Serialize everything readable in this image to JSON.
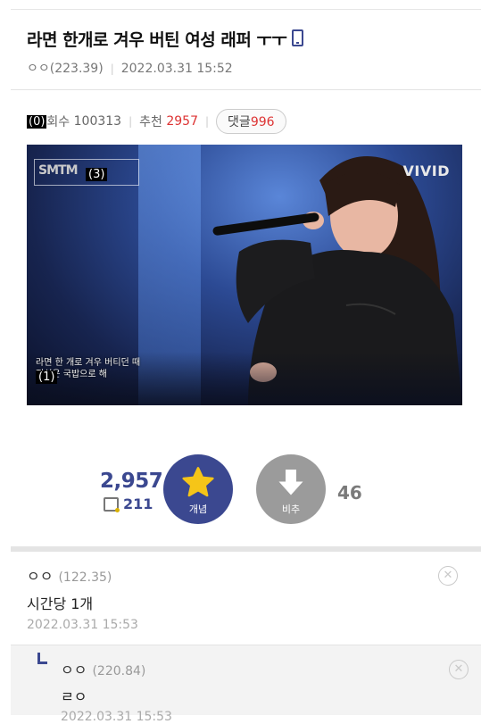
{
  "post": {
    "title": "라면 한개로 겨우 버틴 여성 래퍼 ㅜㅜ",
    "author": "ㅇㅇ",
    "author_ip": "(223.39)",
    "date": "2022.03.31 15:52",
    "views_label": "회수",
    "views": "100313",
    "recommend_label": "추천",
    "recommend": "2957",
    "comments_label": "댓글",
    "comments": "996",
    "marker_views": "(0)"
  },
  "video": {
    "watermark": "VIVID",
    "subtitle_line1": "라면 한 개로 겨우 버티던 때",
    "subtitle_line2": "점심은 국밥으로 해",
    "marker_subtitle": "(1)",
    "marker_logo": "(3)",
    "logo_text": "SMTM"
  },
  "vote": {
    "up_count": "2,957",
    "gold_count": "211",
    "up_label": "개념",
    "down_label": "비추",
    "down_count": "46"
  },
  "comments": [
    {
      "user": "ㅇㅇ",
      "ip": "(122.35)",
      "text": "시간당 1개",
      "date": "2022.03.31 15:53"
    },
    {
      "user": "ㅇㅇ",
      "ip": "(220.84)",
      "text": "ㄹㅇ",
      "date": "2022.03.31 15:53"
    }
  ],
  "colors": {
    "accent": "#3b4890",
    "recommend": "#dd3333",
    "down": "#9b9b9b"
  }
}
